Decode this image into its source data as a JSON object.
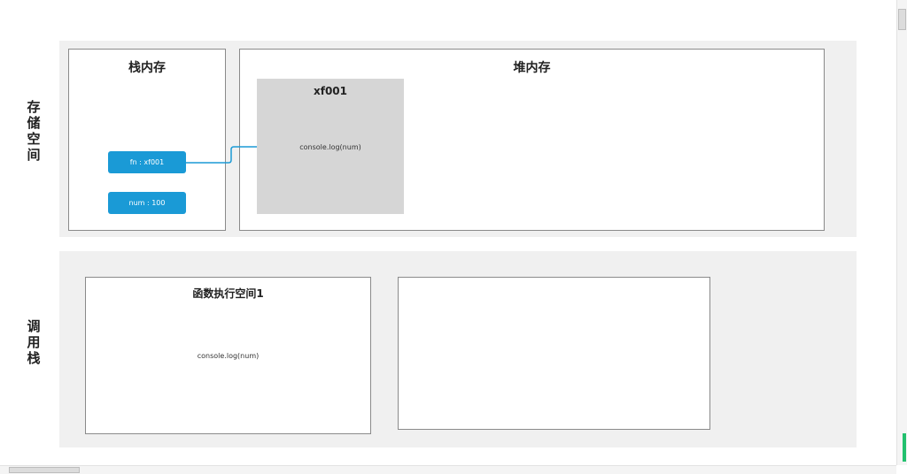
{
  "storage": {
    "side_label": "存储空间",
    "stack": {
      "title": "栈内存",
      "items": [
        {
          "label": "fn : xf001"
        },
        {
          "label": "num : 100"
        }
      ]
    },
    "heap": {
      "title": "堆内存",
      "object": {
        "title": "xf001",
        "content": "console.log(num)"
      }
    }
  },
  "callstack": {
    "side_label": "调用栈",
    "frames": [
      {
        "title": "函数执行空间1",
        "content": "console.log(num)"
      }
    ]
  },
  "colors": {
    "chip": "#1a9ad6",
    "connector": "#1a9ad6",
    "band": "#f0f0f0",
    "heap_object": "#d6d6d6"
  }
}
